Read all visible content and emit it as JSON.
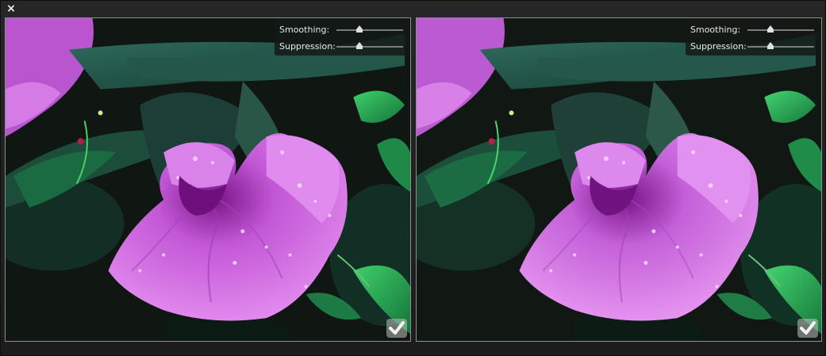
{
  "window": {
    "close_glyph": "×"
  },
  "panels": [
    {
      "id": "left",
      "controls": {
        "smoothing_label": "Smoothing:",
        "smoothing_value": 0.35,
        "suppression_label": "Suppression:",
        "suppression_value": 0.35
      },
      "confirm_icon": "checkmark-icon"
    },
    {
      "id": "right",
      "controls": {
        "smoothing_label": "Smoothing:",
        "smoothing_value": 0.35,
        "suppression_label": "Suppression:",
        "suppression_value": 0.35
      },
      "confirm_icon": "checkmark-icon"
    }
  ],
  "colors": {
    "petal": "#d96be6",
    "petal_dark": "#8a1d9a",
    "leaf": "#1f5a4a",
    "leaf_bright": "#2fb45a"
  }
}
